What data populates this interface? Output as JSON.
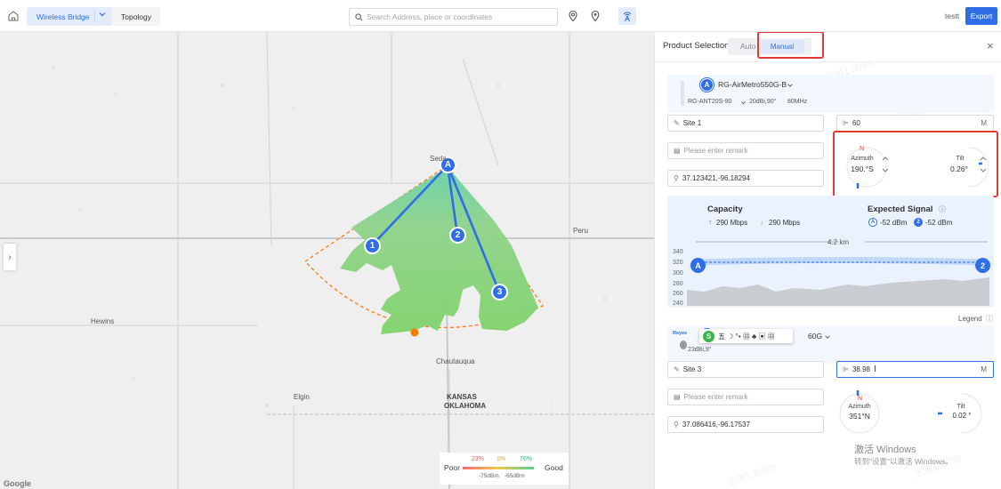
{
  "topbar": {
    "tab_active": "Wireless Bridge",
    "tab_topology": "Topology",
    "search_placeholder": "Search Address, place or coordinates",
    "user": "testt",
    "export_label": "Export"
  },
  "map": {
    "labels": {
      "seneca": "Seda",
      "peru": "Peru",
      "hewins": "Hewins",
      "chautauqua": "Chautauqua",
      "kansas": "KANSAS",
      "oklahoma": "OKLAHOMA",
      "elgin": "Elgin",
      "google": "Google"
    },
    "markers": {
      "hub": "A",
      "n1": "1",
      "n2": "2",
      "n3": "3"
    },
    "legend": {
      "poor": "Poor",
      "good": "Good",
      "pct_red": "23%",
      "pct_yellow": "1%",
      "pct_green": "76%",
      "dbm_low": "-75dBm",
      "dbm_high": "-65dBm"
    },
    "colors": {
      "coverage": "#7fd36a",
      "coverage_near": "#66d3a8",
      "sector_border": "#ff7a1a",
      "link": "#2f6ee6"
    }
  },
  "panel": {
    "title": "Product Selection",
    "mode_auto": "Auto",
    "mode_manual": "Manual",
    "close": "×",
    "device1": {
      "badge": "A",
      "model": "RG-AirMetro550G-B",
      "antenna": "RG-ANT20S-90",
      "gain": "20dBi,90°",
      "bandwidth": "80MHz"
    },
    "site1": {
      "name": "Site 1",
      "height": "60",
      "height_unit": "M",
      "remark_placeholder": "Please enter remark",
      "coords": "37.123421,-96.18294",
      "north": "N",
      "azimuth_label": "Azimuth",
      "azimuth_value": "190.°S",
      "tilt_label": "Tilt",
      "tilt_value": "0.26°"
    },
    "signal": {
      "capacity_title": "Capacity",
      "capacity_up": "290 Mbps",
      "capacity_down": "290 Mbps",
      "expected_title": "Expected Signal",
      "sig_a_badge": "A",
      "sig_a": "-52 dBm",
      "sig_2_badge": "2",
      "sig_2": "-52 dBm",
      "distance": "4.2 km",
      "y_ticks": [
        "340",
        "320",
        "300",
        "280",
        "260",
        "240"
      ],
      "end_a": "A",
      "end_2": "2"
    },
    "legend_link": "Legend",
    "device2": {
      "tag": "Reyee",
      "badge": "2",
      "model_suffix": "60G",
      "gain": "23dBi,9°",
      "popup_glyphs": "五 ☽ °• ▦ ♣ ▣ ▦"
    },
    "site3": {
      "name": "Site 3",
      "height": "38.98",
      "height_unit": "M",
      "remark_placeholder": "Please enter remark",
      "coords": "37.086416,-96.17537",
      "north": "N",
      "azimuth_label": "Azimuth",
      "azimuth_value": "351°N",
      "tilt_label": "Tilt",
      "tilt_value": "0.02 °"
    },
    "activate_title": "激活 Windows",
    "activate_sub": "转到\"设置\"以激活 Windows。",
    "watermark": "王琳1 8039"
  }
}
